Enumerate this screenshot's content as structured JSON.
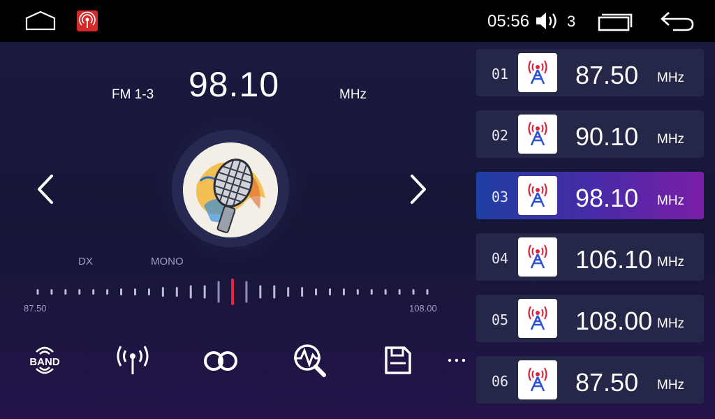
{
  "status_bar": {
    "time": "05:56",
    "volume_level": "3"
  },
  "tuner": {
    "band": "FM 1-3",
    "frequency": "98.10",
    "unit": "MHz",
    "flags": [
      "DX",
      "MONO"
    ],
    "scale_min": "87.50",
    "scale_max": "108.00",
    "tuning_position_fraction": 0.5
  },
  "controls": [
    {
      "name": "band-button",
      "label": "BAND"
    },
    {
      "name": "antenna-button",
      "icon": "antenna-icon"
    },
    {
      "name": "stereo-button",
      "icon": "stereo-icon"
    },
    {
      "name": "auto-scan-button",
      "icon": "scan-search-icon"
    },
    {
      "name": "save-button",
      "icon": "save-icon"
    },
    {
      "name": "more-button",
      "label": "···"
    }
  ],
  "presets": [
    {
      "num": "01",
      "freq": "87.50",
      "unit": "MHz",
      "active": false
    },
    {
      "num": "02",
      "freq": "90.10",
      "unit": "MHz",
      "active": false
    },
    {
      "num": "03",
      "freq": "98.10",
      "unit": "MHz",
      "active": true
    },
    {
      "num": "04",
      "freq": "106.10",
      "unit": "MHz",
      "active": false
    },
    {
      "num": "05",
      "freq": "108.00",
      "unit": "MHz",
      "active": false
    },
    {
      "num": "06",
      "freq": "87.50",
      "unit": "MHz",
      "active": false
    }
  ],
  "colors": {
    "accent_tick": "#e8253c",
    "active_preset_start": "#1f3ea3",
    "active_preset_end": "#7a1ea6",
    "tower_icon_blue": "#2f4fd8",
    "tower_icon_red": "#d8263a"
  }
}
